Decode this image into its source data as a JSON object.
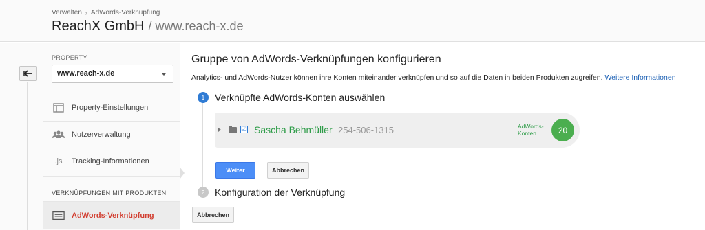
{
  "breadcrumb": [
    "Verwalten",
    "AdWords-Verknüpfung"
  ],
  "breadcrumb_sep": "›",
  "header": {
    "title": "ReachX GmbH",
    "subtitle": "/ www.reach-x.de"
  },
  "sidebar": {
    "property_label": "PROPERTY",
    "property_value": "www.reach-x.de",
    "items": [
      {
        "label": "Property-Einstellungen",
        "icon": "property-settings-icon"
      },
      {
        "label": "Nutzerverwaltung",
        "icon": "users-icon"
      },
      {
        "label": "Tracking-Informationen",
        "icon": "js-icon",
        "icon_text": ".js"
      }
    ],
    "section_title": "VERKNÜPFUNGEN MIT PRODUKTEN",
    "active_item": {
      "label": "AdWords-Verknüpfung",
      "icon": "adwords-icon"
    }
  },
  "main": {
    "title": "Gruppe von AdWords-Verknüpfungen konfigurieren",
    "description": "Analytics- und AdWords-Nutzer können ihre Konten miteinander verknüpfen und so auf die Daten in beiden Produkten zugreifen.",
    "link": "Weitere Informationen",
    "steps": [
      {
        "number": "1",
        "title": "Verknüpfte AdWords-Konten auswählen"
      },
      {
        "number": "2",
        "title": "Konfiguration der Verknüpfung"
      }
    ],
    "account": {
      "name": "Sascha Behmüller",
      "id": "254-506-1315",
      "count_label": "AdWords-Konten",
      "count": "20",
      "checked": "☑"
    },
    "buttons": {
      "next": "Weiter",
      "cancel": "Abbrechen",
      "bottom_cancel": "Abbrechen"
    }
  },
  "colors": {
    "accent": "#2f7bd4",
    "green": "#4bae4f",
    "active_red": "#d23f31"
  }
}
